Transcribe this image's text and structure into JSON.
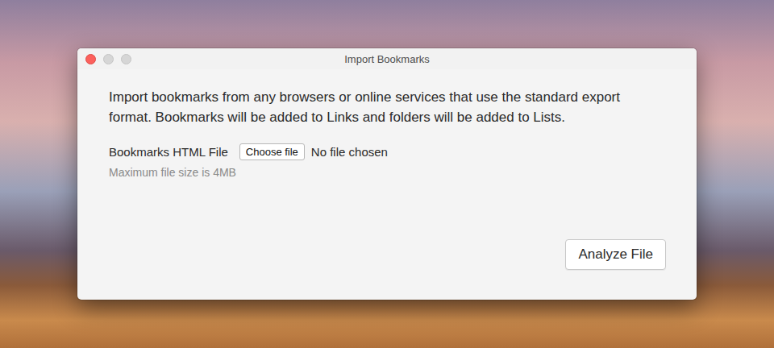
{
  "window": {
    "title": "Import Bookmarks"
  },
  "description": "Import bookmarks from any browsers or online services that use the standard export format. Bookmarks will be added to Links and folders will be added to Lists.",
  "file_field": {
    "label": "Bookmarks HTML File",
    "button": "Choose file",
    "status": "No file chosen",
    "hint": "Maximum file size is 4MB"
  },
  "buttons": [
    "Analyze File"
  ]
}
